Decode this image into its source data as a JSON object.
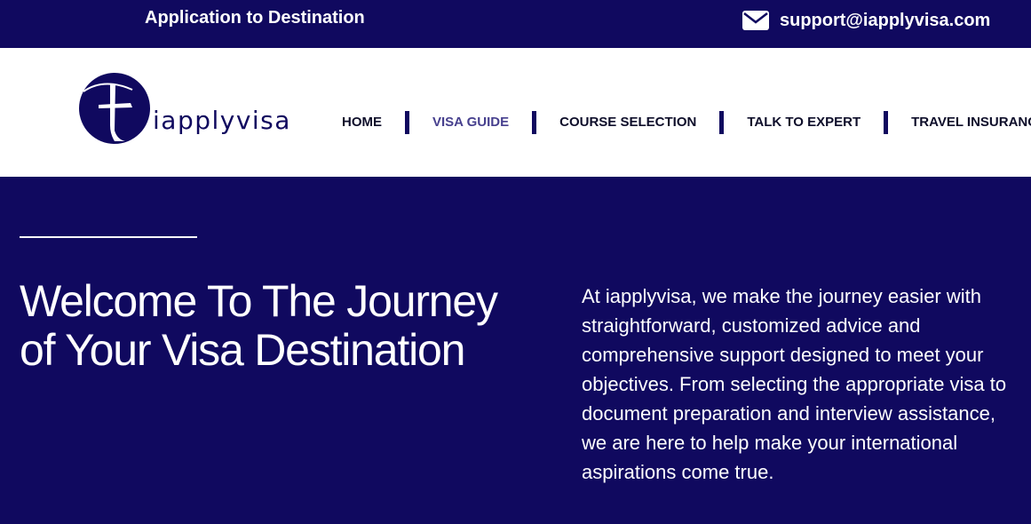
{
  "topbar": {
    "tagline": "Application to Destination",
    "email": "support@iapplyvisa.com",
    "email_icon": "envelope-icon"
  },
  "header": {
    "logo_text": "iapplyvisa",
    "logo_icon": "airplane-circle-logo",
    "nav": [
      {
        "label": "HOME",
        "active": false
      },
      {
        "label": "VISA GUIDE",
        "active": true
      },
      {
        "label": "COURSE SELECTION",
        "active": false
      },
      {
        "label": "TALK TO EXPERT",
        "active": false
      },
      {
        "label": "TRAVEL INSURANCE",
        "active": false
      }
    ]
  },
  "hero": {
    "headline": "Welcome To The Journey of Your Visa Destination",
    "intro": "At iapplyvisa, we make the journey easier with straightforward, customized advice and comprehensive support designed to meet your objectives. From selecting the appropriate visa to document preparation and interview assistance, we are here to help make your international aspirations come true."
  },
  "colors": {
    "brand": "#10095f",
    "nav_active": "#47408e",
    "nav_text": "#0e0e2a",
    "text_light": "#ffffff"
  }
}
